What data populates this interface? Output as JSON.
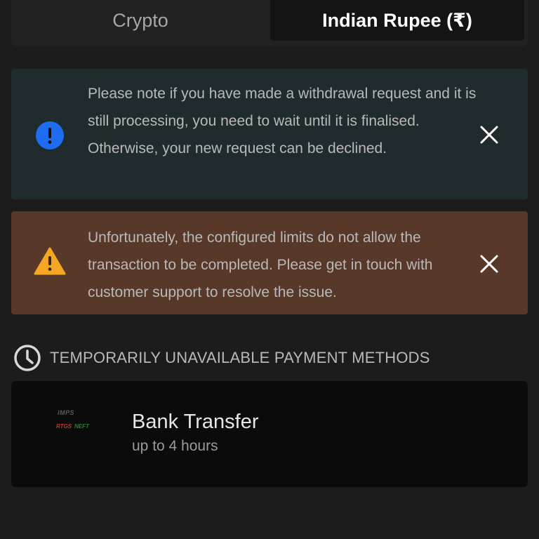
{
  "tabs": [
    {
      "label": "Crypto",
      "active": false
    },
    {
      "label": "Indian Rupee (₹)",
      "active": true
    }
  ],
  "alerts": {
    "info": {
      "icon": "info-icon",
      "color": "#1e6cf0",
      "text": "Please note if you have made a withdrawal request and it is still processing, you need to wait until it is finalised. Otherwise, your new request can be declined."
    },
    "warning": {
      "icon": "warning-icon",
      "color": "#f5a623",
      "text": "Unfortunately, the configured limits do not allow the transaction to be completed. Please get in touch with customer support to resolve the issue."
    }
  },
  "section": {
    "icon": "clock-icon",
    "title": "TEMPORARILY UNAVAILABLE PAYMENT METHODS"
  },
  "payment_methods": [
    {
      "logo": {
        "line1": "IMPS",
        "rtgs": "RTGS",
        "neft": "NEFT"
      },
      "name": "Bank Transfer",
      "time": "up to 4 hours"
    }
  ]
}
